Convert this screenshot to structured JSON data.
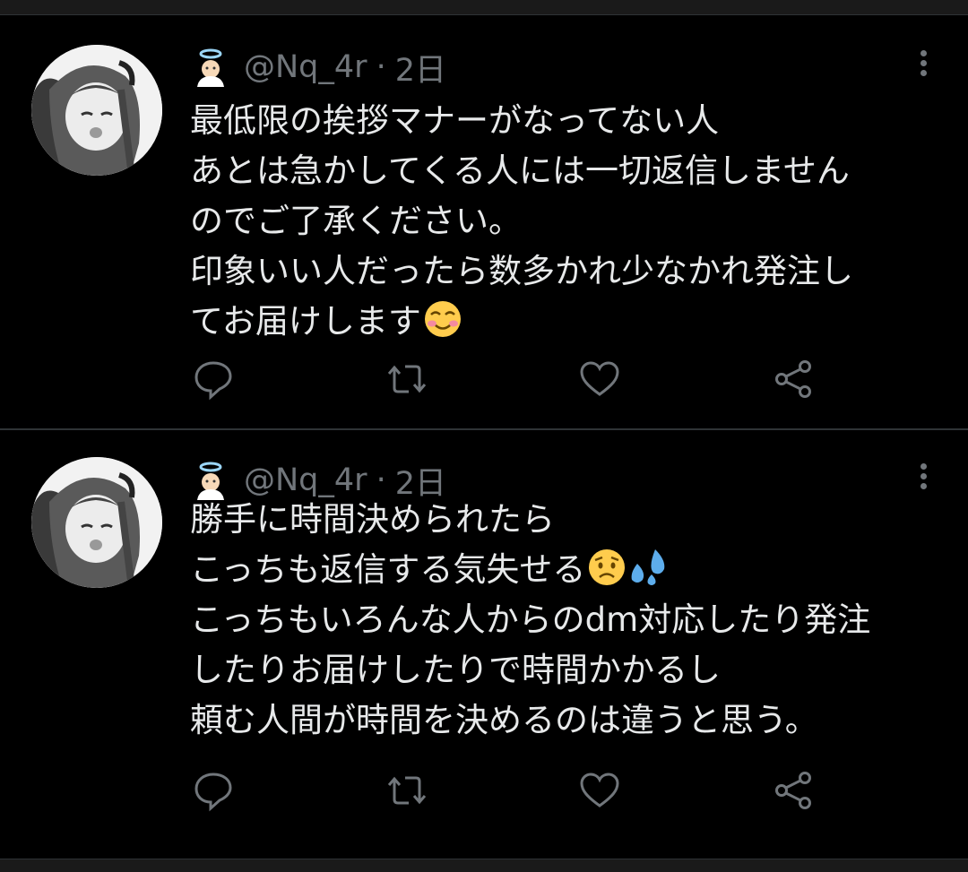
{
  "tweets": [
    {
      "author_handle": "@Nq_4r",
      "separator": "·",
      "time": "2日",
      "lines": [
        "最低限の挨拶マナーがなってない人",
        "あとは急かしてくる人には一切返信しません",
        "のでご了承ください。",
        "印象いい人だったら数多かれ少なかれ発注し",
        "てお届けします"
      ],
      "emojis": [
        "smiling-face-with-blush"
      ]
    },
    {
      "author_handle": "@Nq_4r",
      "separator": "·",
      "time": "2日",
      "lines": [
        "勝手に時間決められたら",
        "こっちも返信する気失せる",
        "こっちもいろんな人からのdm対応したり発注",
        "したりお届けしたりで時間かかるし",
        "頼む人間が時間を決めるのは違うと思う。"
      ],
      "emojis": [
        "worried-face",
        "sweat-droplets"
      ]
    }
  ],
  "icons": {
    "author_badge": "angel-icon",
    "more": "more-vertical-icon",
    "reply": "reply-icon",
    "retweet": "retweet-icon",
    "like": "heart-icon",
    "share": "share-icon"
  },
  "colors": {
    "background": "#000000",
    "text": "#e7e9ea",
    "muted": "#71767b",
    "divider": "#2f3336",
    "sweat_blue": "#5dadec",
    "emoji_yellow": "#ffcc4d"
  }
}
